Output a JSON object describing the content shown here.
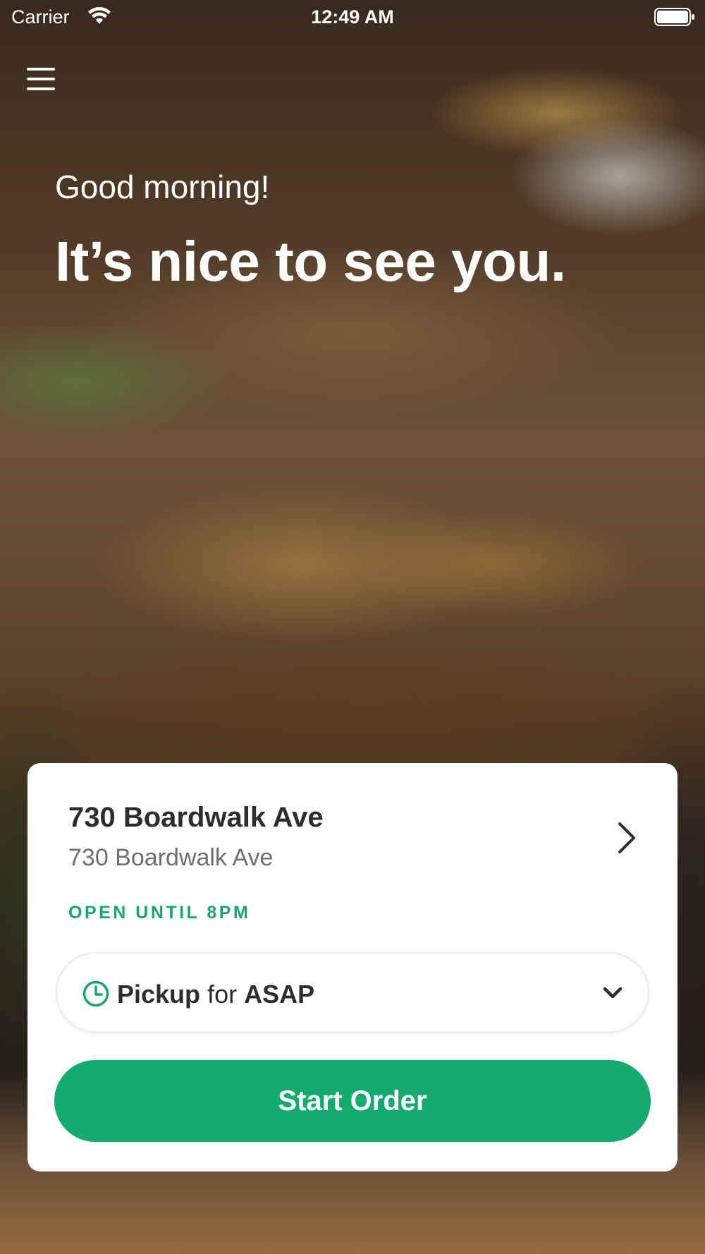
{
  "status_bar": {
    "carrier": "Carrier",
    "time": "12:49 AM",
    "icons": [
      "wifi-icon",
      "battery-icon"
    ]
  },
  "header": {
    "menu_icon": "menu-icon"
  },
  "hero": {
    "greeting": "Good morning!",
    "headline": "It’s nice to see you."
  },
  "location_card": {
    "name": "730 Boardwalk Ave",
    "address": "730 Boardwalk Ave",
    "status": "OPEN UNTIL 8PM",
    "status_color": "#14a86a",
    "order_type": {
      "mode": "Pickup",
      "connector": "for",
      "time": "ASAP",
      "icon": "clock-icon"
    },
    "start_button_label": "Start Order",
    "accent_color": "#14ac6c"
  }
}
